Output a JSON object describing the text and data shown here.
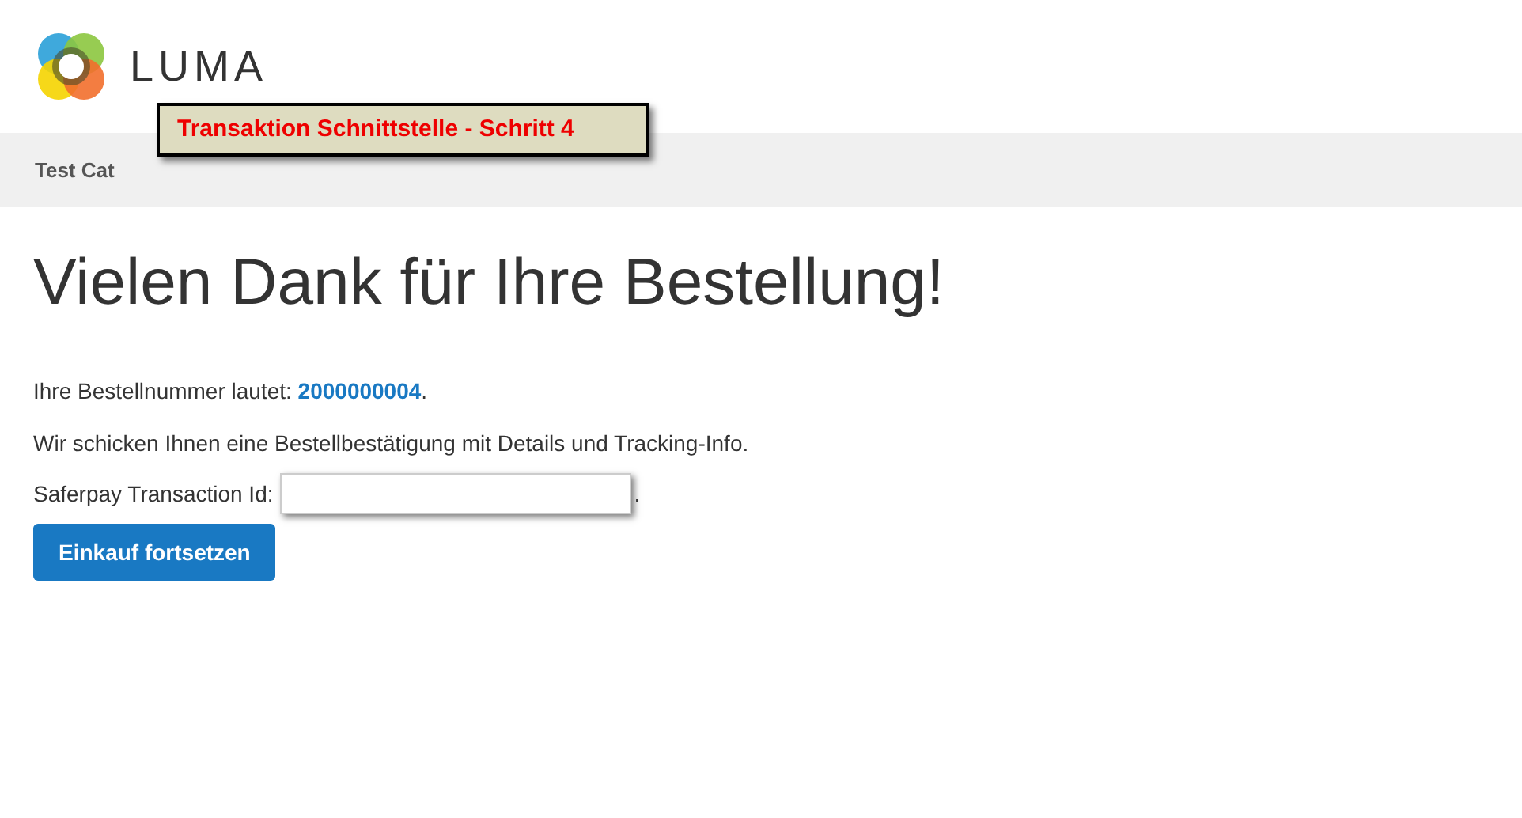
{
  "header": {
    "logo_text": "LUMA"
  },
  "callout": {
    "text": "Transaktion Schnittstelle - Schritt 4"
  },
  "breadcrumb": {
    "text": "Test Cat"
  },
  "page_title": "Vielen Dank für Ihre Bestellung!",
  "order_line": {
    "prefix": "Ihre Bestellnummer lautet: ",
    "order_number": "2000000004",
    "suffix": "."
  },
  "info_text": "Wir schicken Ihnen eine Bestellbestätigung mit Details und Tracking-Info.",
  "transaction": {
    "label": "Saferpay Transaction Id:",
    "suffix": "."
  },
  "button": "Einkauf fortsetzen"
}
